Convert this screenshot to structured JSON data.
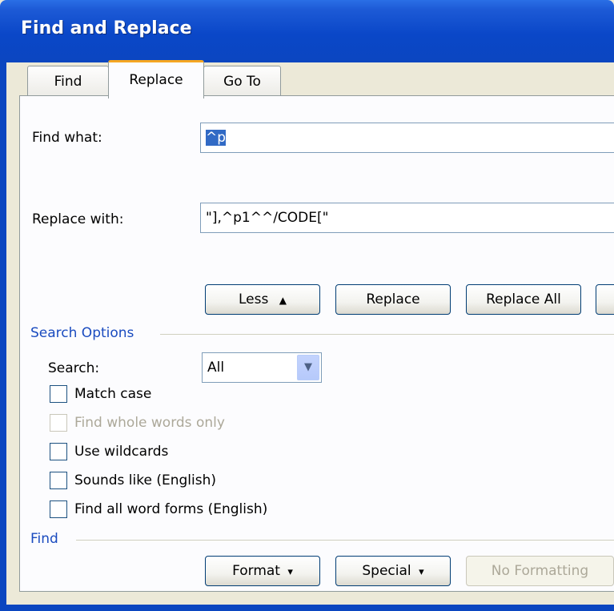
{
  "window": {
    "title": "Find and Replace"
  },
  "tabs": [
    {
      "label": "Find",
      "active": false
    },
    {
      "label": "Replace",
      "active": true
    },
    {
      "label": "Go To",
      "active": false
    }
  ],
  "find": {
    "label": "Find what:",
    "value": "^p"
  },
  "replace": {
    "label": "Replace with:",
    "value": "\"],^p1^^/CODE[\""
  },
  "buttons": {
    "less": "Less",
    "less_icon": "▲",
    "replace": "Replace",
    "replace_all": "Replace All",
    "format": "Format",
    "format_arrow": "▾",
    "special": "Special",
    "special_arrow": "▾",
    "no_formatting": "No Formatting"
  },
  "search_options": {
    "title": "Search Options",
    "search_label": "Search:",
    "search_value": "All",
    "checkboxes": [
      {
        "label": "Match case",
        "checked": false,
        "enabled": true
      },
      {
        "label": "Find whole words only",
        "checked": false,
        "enabled": false
      },
      {
        "label": "Use wildcards",
        "checked": false,
        "enabled": true
      },
      {
        "label": "Sounds like (English)",
        "checked": false,
        "enabled": true
      },
      {
        "label": "Find all word forms (English)",
        "checked": false,
        "enabled": true
      }
    ]
  },
  "find_section": {
    "title": "Find"
  },
  "colors": {
    "titlebar": "#0b46c0",
    "accent_tab": "#f5a623",
    "section": "#1a4bbf"
  },
  "icons": {
    "combo_arrow": "chevron-down-icon"
  }
}
